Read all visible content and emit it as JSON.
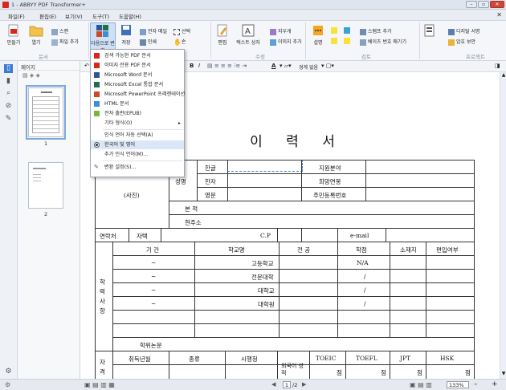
{
  "window": {
    "title": "1 - ABBYY PDF Transformer+"
  },
  "menu": [
    "파일(F)",
    "편집(E)",
    "보기(V)",
    "도구(T)",
    "도움말(H)"
  ],
  "ribbon": {
    "create": "만들기",
    "open": "열기",
    "scan": "스캔",
    "file_add": "파일 추가",
    "convert": "다음으로 변환",
    "save": "저장",
    "email": "전자 메일",
    "print": "인쇄",
    "select": "선택",
    "hand": "손",
    "edit": "편집",
    "textbox": "텍스트 상자",
    "erase": "지우개",
    "image_add": "이미지 추가",
    "note": "설명",
    "stamp_add": "스탬프 추가",
    "bates": "베이츠 번호 매기기",
    "compare": "",
    "digital_sig": "디지털 서명",
    "password": "암호 보안",
    "groups": {
      "doc": "문서",
      "modify": "수정",
      "review": "검토",
      "protect": "프로젝트"
    }
  },
  "dropdown": {
    "items": [
      {
        "label": "검색 가능한 PDF 문서",
        "icon": "pdf-icon",
        "color": "#d8281e"
      },
      {
        "label": "이미지 전용 PDF 문서",
        "icon": "pdf-image-icon",
        "color": "#d8281e"
      },
      {
        "label": "Microsoft Word 문서",
        "icon": "word-icon",
        "color": "#2b5797"
      },
      {
        "label": "Microsoft Excel 통합 문서",
        "icon": "excel-icon",
        "color": "#1e7145"
      },
      {
        "label": "Microsoft PowerPoint 프레젠테이션",
        "icon": "powerpoint-icon",
        "color": "#d24726"
      },
      {
        "label": "HTML 문서",
        "icon": "html-icon",
        "color": "#3a8fd6"
      },
      {
        "label": "전자 출판(EPUB)",
        "icon": "epub-icon",
        "color": "#78b63c"
      },
      {
        "label": "기타 형식(O)",
        "icon": "",
        "color": ""
      },
      {
        "label": "인식 언어 자동 선택(A)",
        "icon": "",
        "color": ""
      },
      {
        "label": "한국어 및 영어",
        "icon": "radio-selected-icon",
        "color": "#333"
      },
      {
        "label": "추가 인식 언어(M)...",
        "icon": "",
        "color": ""
      },
      {
        "label": "변환 설정(S)...",
        "icon": "settings-icon",
        "color": "#555"
      }
    ]
  },
  "panel": {
    "title": "페이지",
    "pages": [
      "1",
      "2"
    ]
  },
  "format_bar": {
    "undo": "↶",
    "bold": "B",
    "italic": "I",
    "border_label": "경계 없음"
  },
  "resume": {
    "title": "이 력 서",
    "photo": "(사진)",
    "name": "성명",
    "hangul": "한글",
    "hanja": "한자",
    "english": "영문",
    "want_field": "지원분야",
    "want_salary": "희망연봉",
    "resident_no": "주민등록번호",
    "origin": "본  적",
    "address": "현주소",
    "contact": "연락처",
    "home": "자택",
    "cp": "C.P",
    "email": "e-mail",
    "edu_side": "학력사항",
    "edu_headers": [
      "기  간",
      "학교명",
      "전  공",
      "학점",
      "소재지",
      "편입여부"
    ],
    "edu_rows": [
      {
        "period": "~",
        "school": "고등학교",
        "grade": "N/A"
      },
      {
        "period": "~",
        "school": "전문대학",
        "grade": "/"
      },
      {
        "period": "~",
        "school": "대학교",
        "grade": "/"
      },
      {
        "period": "~",
        "school": "대학원",
        "grade": "/"
      }
    ],
    "thesis": "학위논문",
    "cert_side": "자격",
    "cert_headers": [
      "취득년월",
      "종류",
      "시행청",
      "외국어 성 적",
      "TOEIC",
      "TOEFL",
      "JPT",
      "HSK"
    ],
    "score_unit": "점"
  },
  "status": {
    "page": "1",
    "of": "/2",
    "zoom": "133%"
  }
}
